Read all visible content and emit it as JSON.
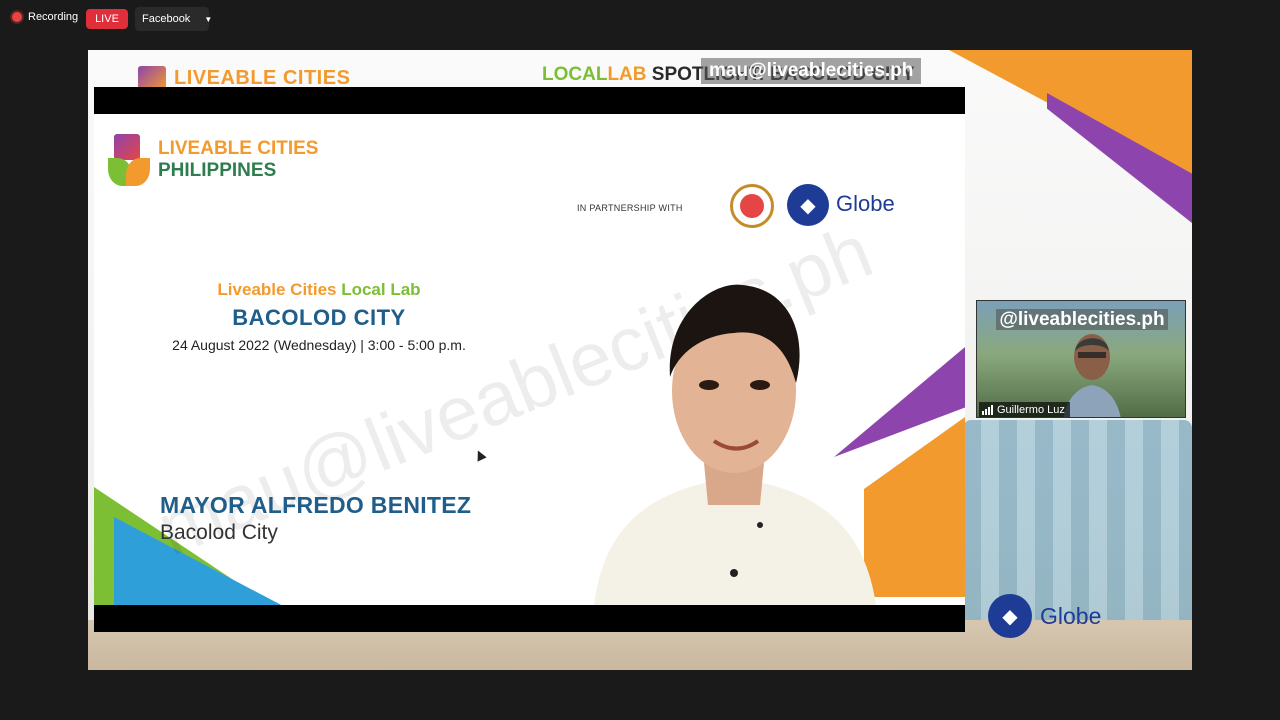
{
  "topbar": {
    "recording_label": "Recording",
    "live_label": "LIVE",
    "destination": "Facebook",
    "colors": {
      "live": "#e02f3b",
      "record_dot": "#e64545"
    }
  },
  "background_slide": {
    "logo_text": "LIVEABLE CITIES",
    "title_part1": "LOCAL",
    "title_part2": "LAB",
    "title_part3": " SPOTLIGHT: BACOLOD CITY",
    "overlay_handle": "mau@liveablecities.ph"
  },
  "slide": {
    "logo_line1": "LIVEABLE CITIES",
    "logo_line2": "PHILIPPINES",
    "partnership_label": "IN PARTNERSHIP WITH",
    "partner_logo_text": "Globe",
    "event_line1a": "Liveable Cities",
    "event_line1b": " Local Lab",
    "event_city": "BACOLOD CITY",
    "event_datetime": "24 August 2022 (Wednesday) | 3:00 - 5:00 p.m.",
    "speaker_name": "MAYOR ALFREDO BENITEZ",
    "speaker_city": "Bacolod City",
    "watermark": "mau@liveablecities.ph"
  },
  "participant": {
    "handle": "@liveablecities.ph",
    "name": "Guillermo Luz"
  },
  "bottom_logo": {
    "text": "Globe"
  },
  "colors": {
    "brand_orange": "#f39a2e",
    "brand_green": "#7cbf35",
    "brand_purple": "#8e44ad",
    "brand_blue": "#1f5e8a",
    "globe_blue": "#1e3c96"
  }
}
